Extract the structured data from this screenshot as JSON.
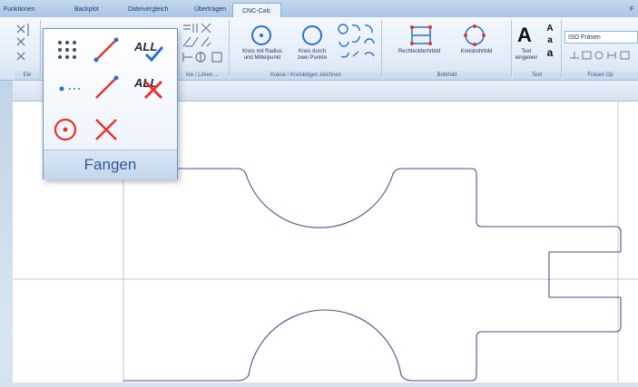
{
  "tabs": [
    {
      "label": "Funktionen"
    },
    {
      "label": "Backplot"
    },
    {
      "label": "Dateivergleich"
    },
    {
      "label": "Übertragen"
    },
    {
      "label": "CNC-Calc"
    },
    {
      "label": "F"
    }
  ],
  "ribbon": {
    "groups": [
      {
        "label": "Ele"
      },
      {
        "label": "kte / Linien ..."
      },
      {
        "label": "Kreise / Kreisbögen zeichnen"
      },
      {
        "label": "Bohrbild"
      },
      {
        "label": "Text"
      },
      {
        "label": "Fräsen Op"
      }
    ],
    "buttons": {
      "circle_radius": [
        "Kreis mit Radius",
        "und Mittelpunkt"
      ],
      "circle_two_points": [
        "Kreis durch",
        "zwei Punkte"
      ],
      "rect_drill": "Rechteckbohrbild",
      "circle_drill": "Kreisbohrbild",
      "text_entry": [
        "Text",
        "eingeben"
      ],
      "text_sizes": [
        "A",
        "a",
        "a"
      ],
      "text_big": "A"
    },
    "combo_value": "ISO Fräsen"
  },
  "popup": {
    "all_label_1": "ALL",
    "all_label_2": "ALL",
    "footer": "Fangen"
  },
  "colors": {
    "accent_red": "#e4342b",
    "accent_blue": "#2d6fd0",
    "drawing_line": "#4b4f86",
    "ribbon_icon": "#6b7ea2"
  }
}
